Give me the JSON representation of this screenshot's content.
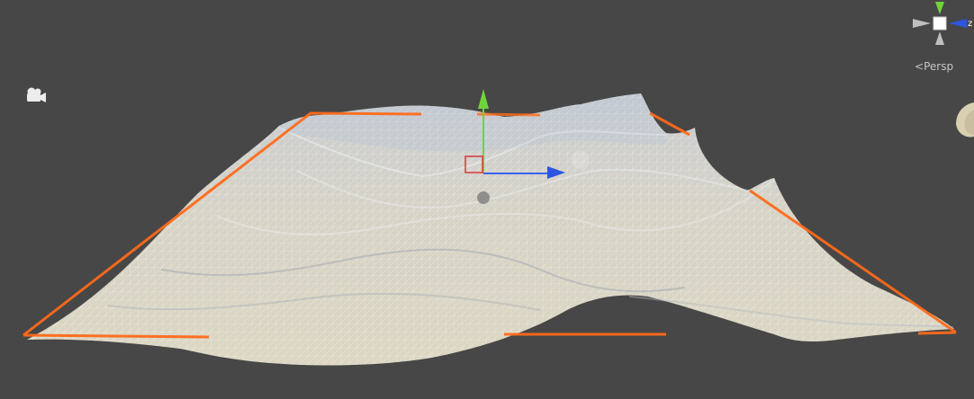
{
  "view": {
    "mode_label": "Persp",
    "mode_prefix_glyph": "<",
    "background_color": "#474747"
  },
  "orientation_gizmo": {
    "axis_label_z": "z",
    "axis_colors": {
      "x": "#d43c3c",
      "y": "#6fd43c",
      "z": "#2d55e0"
    }
  },
  "selection": {
    "outline_color": "#ff6a1a",
    "object_type": "terrain-mesh",
    "mesh_fill_color": "#d7d3c4",
    "wire_color": "#ffffff",
    "wire_tint": "#9fbde0"
  },
  "transform_handle": {
    "x_color": "#2d55e0",
    "y_color": "#6fd43c",
    "plane_color": "#d43c3c"
  },
  "icons": {
    "camera": "camera-icon",
    "gizmo": "orientation-gizmo-icon"
  }
}
